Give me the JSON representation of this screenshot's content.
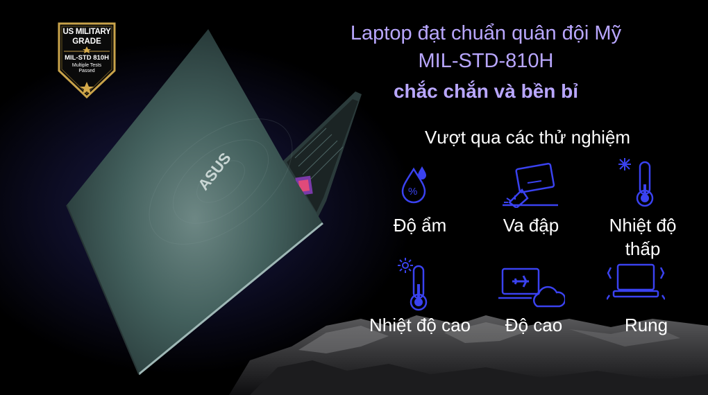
{
  "badge": {
    "line1": "US MILITARY",
    "line2": "GRADE",
    "line3": "MIL-STD 810H",
    "line4": "Multiple Tests Passed"
  },
  "laptop": {
    "brand": "ASUS"
  },
  "headline": {
    "line1": "Laptop đạt chuẩn quân đội Mỹ",
    "line2": "MIL-STD-810H",
    "line3": "chắc chắn và bền bỉ"
  },
  "subtitle": "Vượt qua các thử nghiệm",
  "features": [
    {
      "label": "Độ ẩm",
      "icon": "humidity-icon"
    },
    {
      "label": "Va đập",
      "icon": "shock-icon"
    },
    {
      "label": "Nhiệt độ thấp",
      "icon": "low-temperature-icon"
    },
    {
      "label": "Nhiệt độ cao",
      "icon": "high-temperature-icon"
    },
    {
      "label": "Độ cao",
      "icon": "altitude-icon"
    },
    {
      "label": "Rung",
      "icon": "vibration-icon"
    }
  ],
  "colors": {
    "accent": "#b9a7ff",
    "icon": "#3a42f0",
    "background": "#000000",
    "laptop": "#3d5553"
  }
}
